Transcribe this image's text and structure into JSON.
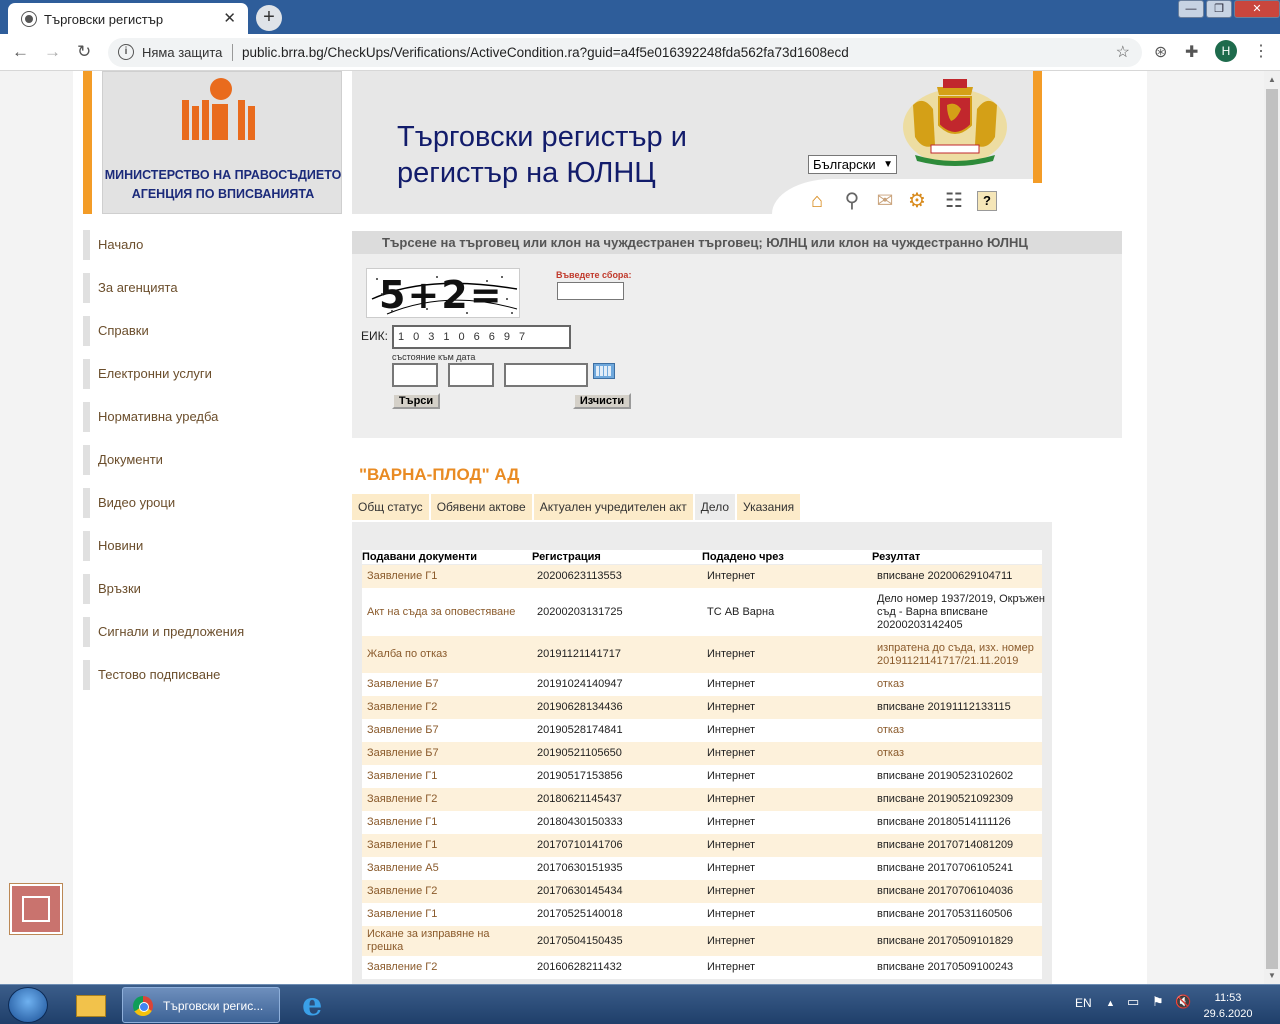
{
  "browser": {
    "tab_title": "Търговски регистър",
    "address_security": "Няма защита",
    "url": "public.brra.bg/CheckUps/Verifications/ActiveCondition.ra?guid=a4f5e016392248fda562fa73d1608ecd",
    "profile_initial": "H"
  },
  "header": {
    "ministry_line1": "МИНИСТЕРСТВО НА ПРАВОСЪДИЕТО",
    "ministry_line2": "АГЕНЦИЯ ПО ВПИСВАНИЯТА",
    "title_line1": "Търговски регистър и",
    "title_line2": "регистър на ЮЛНЦ",
    "language": "Български"
  },
  "menu": [
    "Начало",
    "За агенцията",
    "Справки",
    "Електронни услуги",
    "Нормативна уредба",
    "Документи",
    "Видео уроци",
    "Новини",
    "Връзки",
    "Сигнали и предложения",
    "Тестово подписване"
  ],
  "search": {
    "heading": "Търсене на търговец или клон на чуждестранен търговец; ЮЛНЦ или клон на чуждестранно ЮЛНЦ",
    "captcha_text": "5+2=",
    "captcha_label": "Въведете сбора:",
    "eik_label": "ЕИК:",
    "eik_value": "103106697",
    "date_label": "състояние към дата",
    "search_button": "Търси",
    "clear_button": "Изчисти"
  },
  "company": {
    "name": "\"ВАРНА-ПЛОД\" АД",
    "tabs": [
      "Общ статус",
      "Обявени актове",
      "Актуален учредителен акт",
      "Дело",
      "Указания"
    ],
    "active_tab": "Дело"
  },
  "table": {
    "headers": [
      "Подавани документи",
      "Регистрация",
      "Подадено чрез",
      "Резултат"
    ],
    "rows": [
      [
        "Заявление Г1",
        "20200623113553",
        "Интернет",
        "вписване 20200629104711"
      ],
      [
        "Акт на съда за оповестяване",
        "20200203131725",
        "ТС АВ Варна",
        "Дело номер 1937/2019, Окръжен съд - Варна вписване 20200203142405"
      ],
      [
        "Жалба по отказ",
        "20191121141717",
        "Интернет",
        "изпратена до съда, изх. номер 20191121141717/21.11.2019"
      ],
      [
        "Заявление Б7",
        "20191024140947",
        "Интернет",
        "отказ"
      ],
      [
        "Заявление Г2",
        "20190628134436",
        "Интернет",
        "вписване 20191112133115"
      ],
      [
        "Заявление Б7",
        "20190528174841",
        "Интернет",
        "отказ"
      ],
      [
        "Заявление Б7",
        "20190521105650",
        "Интернет",
        "отказ"
      ],
      [
        "Заявление Г1",
        "20190517153856",
        "Интернет",
        "вписване 20190523102602"
      ],
      [
        "Заявление Г2",
        "20180621145437",
        "Интернет",
        "вписване 20190521092309"
      ],
      [
        "Заявление Г1",
        "20180430150333",
        "Интернет",
        "вписване 20180514111126"
      ],
      [
        "Заявление Г1",
        "20170710141706",
        "Интернет",
        "вписване 20170714081209"
      ],
      [
        "Заявление А5",
        "20170630151935",
        "Интернет",
        "вписване 20170706105241"
      ],
      [
        "Заявление Г2",
        "20170630145434",
        "Интернет",
        "вписване 20170706104036"
      ],
      [
        "Заявление Г1",
        "20170525140018",
        "Интернет",
        "вписване 20170531160506"
      ],
      [
        "Искане за изправяне на грешка",
        "20170504150435",
        "Интернет",
        "вписване 20170509101829"
      ],
      [
        "Заявление Г2",
        "20160628211432",
        "Интернет",
        "вписване 20170509100243"
      ]
    ]
  },
  "taskbar": {
    "chrome_label": "Търговски регис...",
    "lang": "EN",
    "time": "11:53",
    "date": "29.6.2020"
  }
}
